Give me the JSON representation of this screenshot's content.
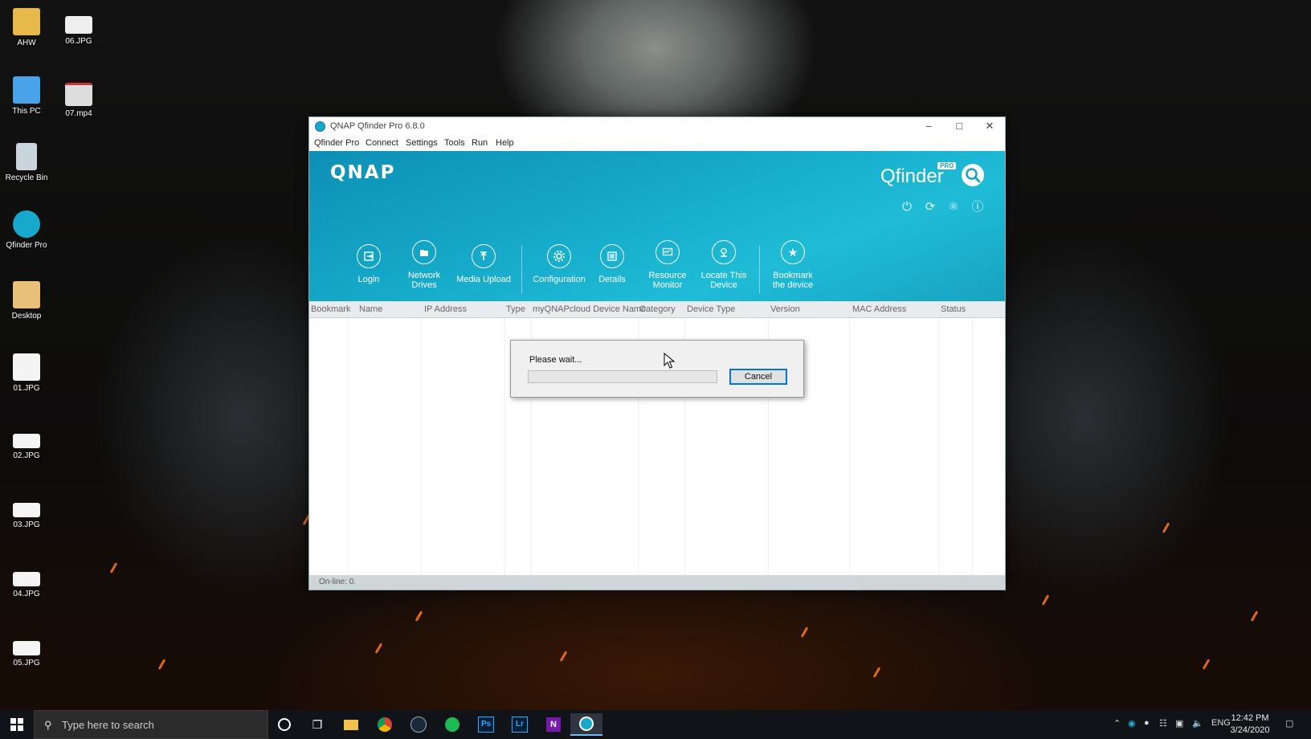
{
  "desktop": {
    "icons": [
      {
        "label": "AHW",
        "icon": "folder-user-icon"
      },
      {
        "label": "06.JPG",
        "icon": "image-file-icon"
      },
      {
        "label": "This PC",
        "icon": "computer-icon"
      },
      {
        "label": "07.mp4",
        "icon": "video-file-icon"
      },
      {
        "label": "Recycle Bin",
        "icon": "recycle-bin-icon"
      },
      {
        "label": "Qfinder Pro",
        "icon": "qfinder-icon"
      },
      {
        "label": "Desktop",
        "icon": "folder-icon"
      },
      {
        "label": "01.JPG",
        "icon": "image-file-icon"
      },
      {
        "label": "02.JPG",
        "icon": "image-file-icon"
      },
      {
        "label": "03.JPG",
        "icon": "image-file-icon"
      },
      {
        "label": "04.JPG",
        "icon": "image-file-icon"
      },
      {
        "label": "05.JPG",
        "icon": "image-file-icon"
      }
    ]
  },
  "window": {
    "title": "QNAP Qfinder Pro 6.8.0",
    "menu": [
      "Qfinder Pro",
      "Connect",
      "Settings",
      "Tools",
      "Run",
      "Help"
    ],
    "brand": "QNAP",
    "product": "Qfinder",
    "product_badge": "PRO",
    "top_icons": [
      "power-icon",
      "refresh-icon",
      "globe-icon",
      "info-icon"
    ],
    "toolbar": [
      {
        "line1": "Login",
        "line2": "",
        "icon": "login-icon"
      },
      {
        "line1": "Network",
        "line2": "Drives",
        "icon": "network-drives-icon"
      },
      {
        "line1": "Media Upload",
        "line2": "",
        "icon": "upload-icon"
      },
      {
        "line1": "Configuration",
        "line2": "",
        "icon": "gear-icon"
      },
      {
        "line1": "Details",
        "line2": "",
        "icon": "details-icon"
      },
      {
        "line1": "Resource",
        "line2": "Monitor",
        "icon": "monitor-icon"
      },
      {
        "line1": "Locate This",
        "line2": "Device",
        "icon": "locate-icon"
      },
      {
        "line1": "Bookmark",
        "line2": "the device",
        "icon": "star-icon"
      }
    ],
    "columns": [
      "Bookmark",
      "Name",
      "IP Address",
      "Type",
      "myQNAPcloud Device Name",
      "Category",
      "Device Type",
      "Version",
      "MAC Address",
      "Status"
    ],
    "status": "On-line: 0."
  },
  "dialog": {
    "message": "Please wait...",
    "progress": 0.0,
    "cancel_label": "Cancel"
  },
  "taskbar": {
    "search_placeholder": "Type here to search",
    "apps": [
      "cortana-icon",
      "task-view-icon",
      "file-explorer-icon",
      "chrome-icon",
      "steam-icon",
      "spotify-icon",
      "photoshop-icon",
      "lightroom-icon",
      "onenote-icon",
      "qfinder-icon"
    ],
    "app_labels": {
      "photoshop": "Ps",
      "lightroom": "Lr",
      "onenote": "N"
    },
    "language": "ENG",
    "time": "12:42 PM",
    "date": "3/24/2020"
  },
  "colors": {
    "banner": "#15a8c9",
    "accent": "#0078d7",
    "taskbar": "#101318"
  }
}
